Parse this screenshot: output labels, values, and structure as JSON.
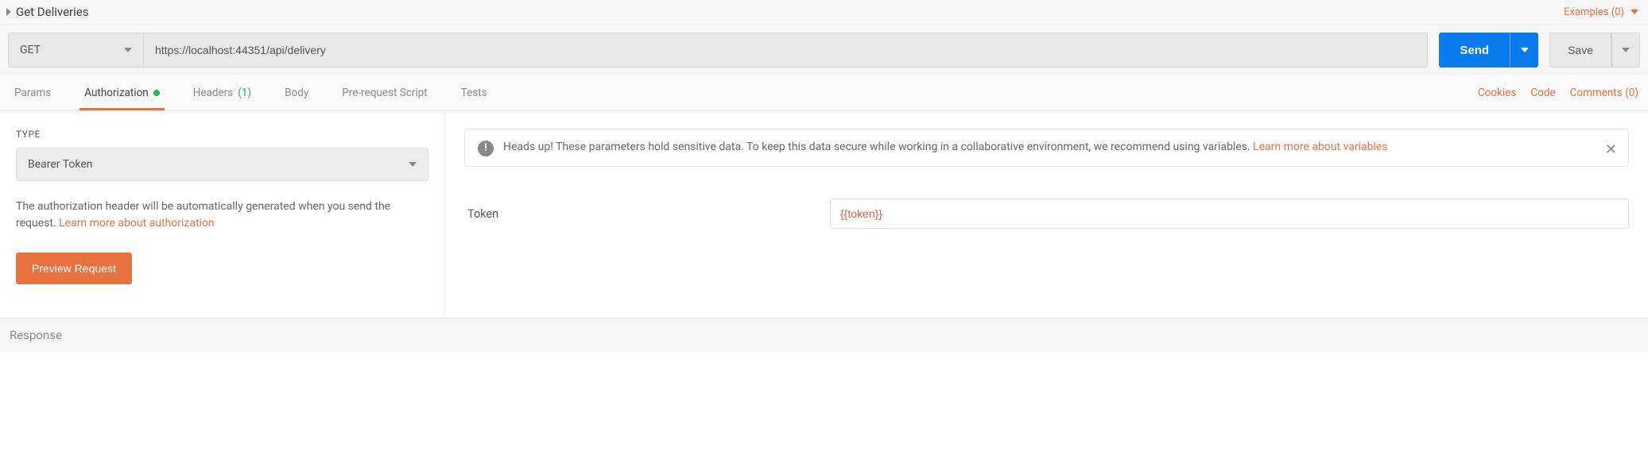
{
  "header": {
    "title": "Get Deliveries",
    "examples_label": "Examples (0)"
  },
  "request": {
    "method": "GET",
    "url": "https://localhost:44351/api/delivery",
    "send_label": "Send",
    "save_label": "Save"
  },
  "tabs": {
    "items": [
      {
        "label": "Params"
      },
      {
        "label": "Authorization",
        "active": true,
        "dot": true
      },
      {
        "label": "Headers",
        "count": "(1)"
      },
      {
        "label": "Body"
      },
      {
        "label": "Pre-request Script"
      },
      {
        "label": "Tests"
      }
    ],
    "right": {
      "cookies": "Cookies",
      "code": "Code",
      "comments": "Comments (0)"
    }
  },
  "auth": {
    "type_label": "TYPE",
    "type_value": "Bearer Token",
    "desc_prefix": "The authorization header will be automatically generated when you send the request. ",
    "desc_link": "Learn more about authorization",
    "preview_label": "Preview Request",
    "alert_text": "Heads up! These parameters hold sensitive data. To keep this data secure while working in a collaborative environment, we recommend using variables. ",
    "alert_link": "Learn more about variables",
    "token_label": "Token",
    "token_value": "{{token}}"
  },
  "response": {
    "label": "Response"
  }
}
